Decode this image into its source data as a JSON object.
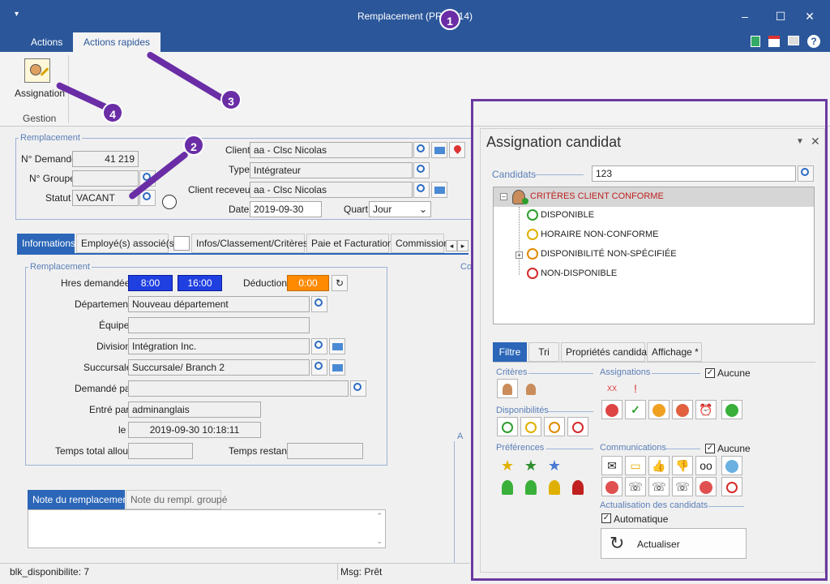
{
  "window": {
    "title": "Remplacement (PRIM014)"
  },
  "ribbon": {
    "tabs": [
      "Actions",
      "Actions rapides"
    ],
    "assign_label": "Assignation",
    "group_label": "Gestion"
  },
  "form": {
    "group_title": "Remplacement",
    "no_demande_label": "N° Demande",
    "no_demande_value": "41 219",
    "no_groupe_label": "N° Groupe",
    "statut_label": "Statut",
    "statut_value": "VACANT",
    "client_label": "Client",
    "client_value": "aa - Clsc Nicolas",
    "type_label": "Type",
    "type_value": "Intégrateur",
    "client_receveur_label": "Client receveur",
    "client_receveur_value": "aa - Clsc Nicolas",
    "date_label": "Date",
    "date_value": "2019-09-30",
    "quart_label": "Quart",
    "quart_value": "Jour"
  },
  "tabs": [
    "Informations",
    "Employé(s) associé(s)",
    "Infos/Classement/Critères",
    "Paie et Facturation",
    "Commission"
  ],
  "info": {
    "group_title": "Remplacement",
    "hres_label": "Hres demandées",
    "hres_start": "8:00",
    "hres_end": "16:00",
    "deduction_label": "Déduction",
    "deduction_value": "0:00",
    "departement_label": "Département",
    "departement_value": "Nouveau département",
    "equipe_label": "Équipe",
    "division_label": "Division",
    "division_value": "Intégration Inc.",
    "succursale_label": "Succursale",
    "succursale_value": "Succursale/ Branch 2",
    "demande_par_label": "Demandé par",
    "entre_par_label": "Entré par",
    "entre_par_value": "adminanglais",
    "le_label": "le",
    "le_value": "2019-09-30 10:18:11",
    "temps_total_label": "Temps total alloué",
    "temps_restant_label": "Temps restant",
    "co_label": "Co",
    "a_label": "A"
  },
  "note_tabs": [
    "Note du remplacement",
    "Note du rempl. groupé"
  ],
  "status": {
    "left": "blk_disponibilite: 7",
    "right": "Msg: Prêt"
  },
  "panel": {
    "title": "Assignation candidat",
    "candidats_label": "Candidats",
    "candidats_value": "123",
    "tree": {
      "root": "CRITÈRES CLIENT CONFORME",
      "items": [
        {
          "label": "DISPONIBLE",
          "color": "#2e9e2e"
        },
        {
          "label": "HORAIRE NON-CONFORME",
          "color": "#e0b000"
        },
        {
          "label": "DISPONIBILITÉ NON-SPÉCIFIÉE",
          "color": "#e08a00"
        },
        {
          "label": "NON-DISPONIBLE",
          "color": "#d42a2a"
        }
      ]
    },
    "filter_tabs": [
      "Filtre",
      "Tri",
      "Propriétés candidat",
      "Affichage *"
    ],
    "criteres_label": "Critères",
    "assignations_label": "Assignations",
    "aucune_label": "Aucune",
    "disponibilites_label": "Disponibilités",
    "preferences_label": "Préférences",
    "communications_label": "Communications",
    "actualisation_label": "Actualisation des candidats",
    "automatique_label": "Automatique",
    "actualiser_label": "Actualiser"
  },
  "annotations": [
    "1",
    "2",
    "3",
    "4"
  ]
}
